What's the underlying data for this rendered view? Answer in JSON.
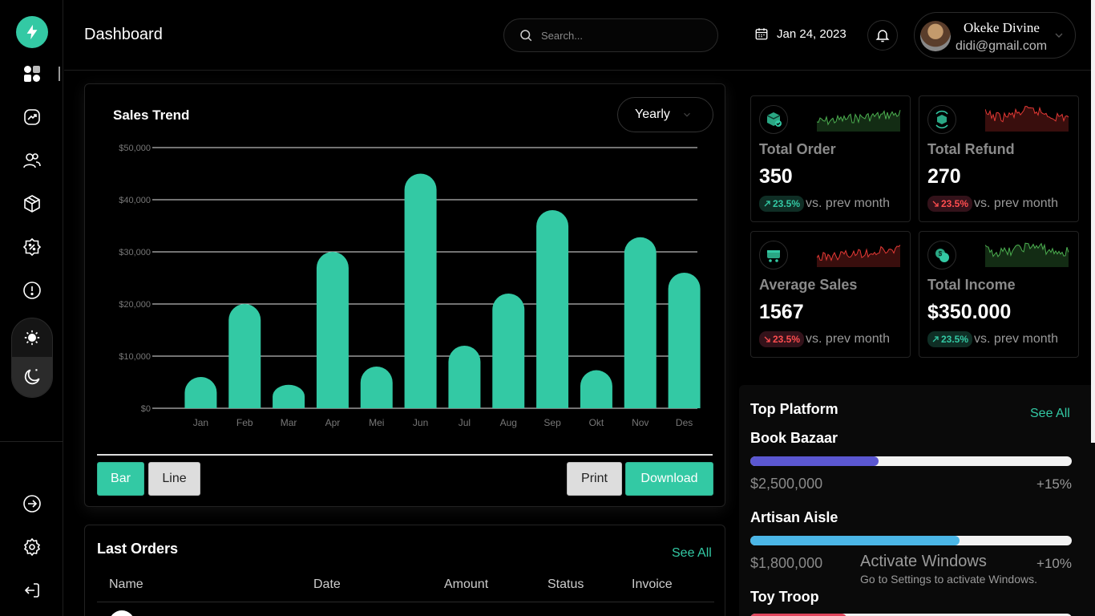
{
  "header": {
    "title": "Dashboard",
    "search_placeholder": "Search...",
    "date": "Jan 24, 2023",
    "user_name": "Okeke Divine",
    "user_email": "didi@gmail.com"
  },
  "sidebar": {
    "nav_icons": [
      "dashboard-icon",
      "trend-icon",
      "users-icon",
      "box-icon",
      "badge-icon",
      "info-icon"
    ],
    "bottom_icons": [
      "arrow-right-icon",
      "settings-icon",
      "logout-icon"
    ],
    "theme": [
      "sun-icon",
      "moon-icon"
    ]
  },
  "sales": {
    "title": "Sales Trend",
    "period": "Yearly",
    "bar_label": "Bar",
    "line_label": "Line",
    "print_label": "Print",
    "download_label": "Download"
  },
  "chart_data": {
    "type": "bar",
    "title": "Sales Trend",
    "categories": [
      "Jan",
      "Feb",
      "Mar",
      "Apr",
      "Mei",
      "Jun",
      "Jul",
      "Aug",
      "Sep",
      "Okt",
      "Nov",
      "Des"
    ],
    "values": [
      6000,
      20000,
      4500,
      30000,
      8000,
      45000,
      12000,
      22000,
      38000,
      7300,
      32800,
      26000
    ],
    "ylim": [
      0,
      50000
    ],
    "yticks": [
      "$0",
      "$10,000",
      "$20,000",
      "$30,000",
      "$40,000",
      "$50,000"
    ],
    "grid": true,
    "color": "#33c9a4"
  },
  "orders": {
    "title": "Last Orders",
    "see_all": "See All",
    "columns": [
      "Name",
      "Date",
      "Amount",
      "Status",
      "Invoice"
    ]
  },
  "stats": [
    {
      "label": "Total Order",
      "value": "350",
      "change": "23.5%",
      "trend": "up",
      "prev": "vs. prev month",
      "icon": "cube-icon",
      "spark_color": "#4caf50"
    },
    {
      "label": "Total Refund",
      "value": "270",
      "change": "23.5%",
      "trend": "down",
      "prev": "vs. prev month",
      "icon": "refund-box-icon",
      "spark_color": "#e53935"
    },
    {
      "label": "Average Sales",
      "value": "1567",
      "change": "23.5%",
      "trend": "down",
      "prev": "vs. prev month",
      "icon": "cart-icon",
      "spark_color": "#e53935"
    },
    {
      "label": "Total Income",
      "value": "$350.000",
      "change": "23.5%",
      "trend": "up",
      "prev": "vs. prev month",
      "icon": "coin-icon",
      "spark_color": "#4caf50"
    }
  ],
  "platform": {
    "title": "Top Platform",
    "see_all": "See All",
    "items": [
      {
        "name": "Book Bazaar",
        "amount": "$2,500,000",
        "pct": "+15%",
        "progress": 0.4,
        "color": "#5b57d1"
      },
      {
        "name": "Artisan Aisle",
        "amount": "$1,800,000",
        "pct": "+10%",
        "progress": 0.65,
        "color": "#4bb6e6"
      },
      {
        "name": "Toy Troop",
        "amount": "",
        "pct": "",
        "progress": 0.3,
        "color": "#e0455c"
      }
    ]
  },
  "watermark": {
    "line1": "Activate Windows",
    "line2": "Go to Settings to activate Windows."
  }
}
